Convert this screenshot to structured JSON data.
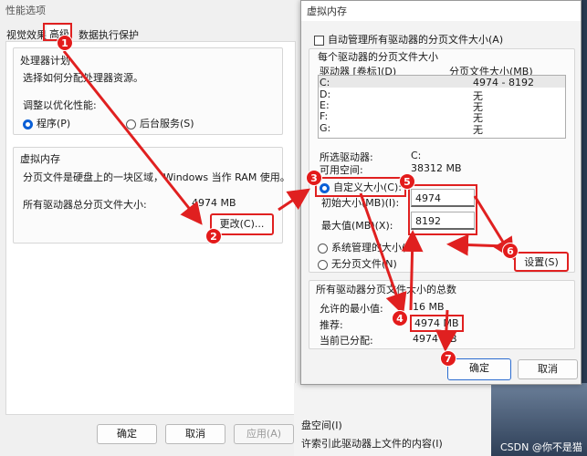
{
  "bg_window": {
    "title": "性能选项",
    "tabs": [
      "视觉效果",
      "高级",
      "数据执行保护"
    ],
    "processor": {
      "header": "处理器计划",
      "desc": "选择如何分配处理器资源。",
      "adjust_label": "调整以优化性能:",
      "radio_programs": "程序(P)",
      "radio_background": "后台服务(S)"
    },
    "virtual_memory": {
      "header": "虚拟内存",
      "desc": "分页文件是硬盘上的一块区域，Windows 当作 RAM 使用。",
      "total_label": "所有驱动器总分页文件大小:",
      "total_value": "4974 MB",
      "change_button": "更改(C)..."
    },
    "buttons": {
      "ok": "确定",
      "cancel": "取消",
      "apply": "应用(A)"
    }
  },
  "right_strip": {
    "text1": "盘空间(I)",
    "text2": "许索引此驱动器上文件的内容(I)"
  },
  "vm_dialog": {
    "title": "虚拟内存",
    "auto_manage": "自动管理所有驱动器的分页文件大小(A)",
    "section_title": "每个驱动器的分页文件大小",
    "col_drive": "驱动器 [卷标](D)",
    "col_size": "分页文件大小(MB)",
    "drives": [
      {
        "name": "C:",
        "size": "4974 - 8192"
      },
      {
        "name": "D:",
        "size": "无"
      },
      {
        "name": "E:",
        "size": "无"
      },
      {
        "name": "F:",
        "size": "无"
      },
      {
        "name": "G:",
        "size": "无"
      }
    ],
    "selected_drive_label": "所选驱动器:",
    "selected_drive_value": "C:",
    "free_space_label": "可用空间:",
    "free_space_value": "38312 MB",
    "custom_size": "自定义大小(C):",
    "initial_label": "初始大小(MB)(I):",
    "initial_value": "4974",
    "max_label": "最大值(MB)(X):",
    "max_value": "8192",
    "system_managed": "系统管理的大小(Y)",
    "no_paging": "无分页文件(N)",
    "set_button": "设置(S)",
    "total_section": "所有驱动器分页文件大小的总数",
    "min_allowed_label": "允许的最小值:",
    "min_allowed_value": "16 MB",
    "recommended_label": "推荐:",
    "recommended_value": "4974 MB",
    "current_label": "当前已分配:",
    "current_value": "4974 MB",
    "ok": "确定",
    "cancel": "取消"
  },
  "annotations": {
    "steps": [
      "1",
      "2",
      "3",
      "4",
      "5",
      "6",
      "7"
    ],
    "color": "#e02020"
  },
  "watermark": "CSDN @你不是猫"
}
